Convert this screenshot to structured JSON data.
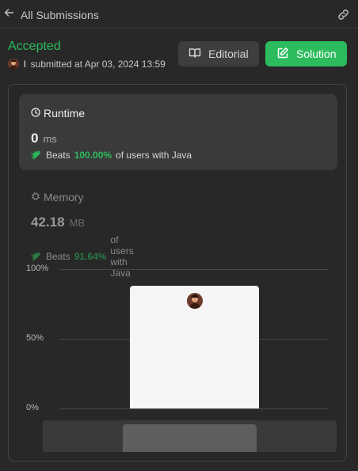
{
  "header": {
    "back_label": "All Submissions"
  },
  "submission": {
    "status": "Accepted",
    "user": "l",
    "submitted_text": "submitted at Apr 03, 2024 13:59"
  },
  "actions": {
    "editorial_label": "Editorial",
    "solution_label": "Solution"
  },
  "runtime": {
    "title": "Runtime",
    "value": "0",
    "unit": "ms",
    "beats_label": "Beats",
    "beats_pct": "100.00%",
    "beats_suffix": "of users with Java"
  },
  "memory": {
    "title": "Memory",
    "value": "42.18",
    "unit": "MB",
    "beats_label": "Beats",
    "beats_pct": "91.64%",
    "beats_suffix": "of users with Java"
  },
  "chart_data": {
    "type": "bar",
    "y_ticks": [
      "100%",
      "50%",
      "0%"
    ],
    "ylim": [
      0,
      100
    ],
    "values": [
      88
    ],
    "grid": true
  },
  "colors": {
    "accent": "#2cbb5d",
    "background": "#282828",
    "card": "#3a3a3a"
  }
}
